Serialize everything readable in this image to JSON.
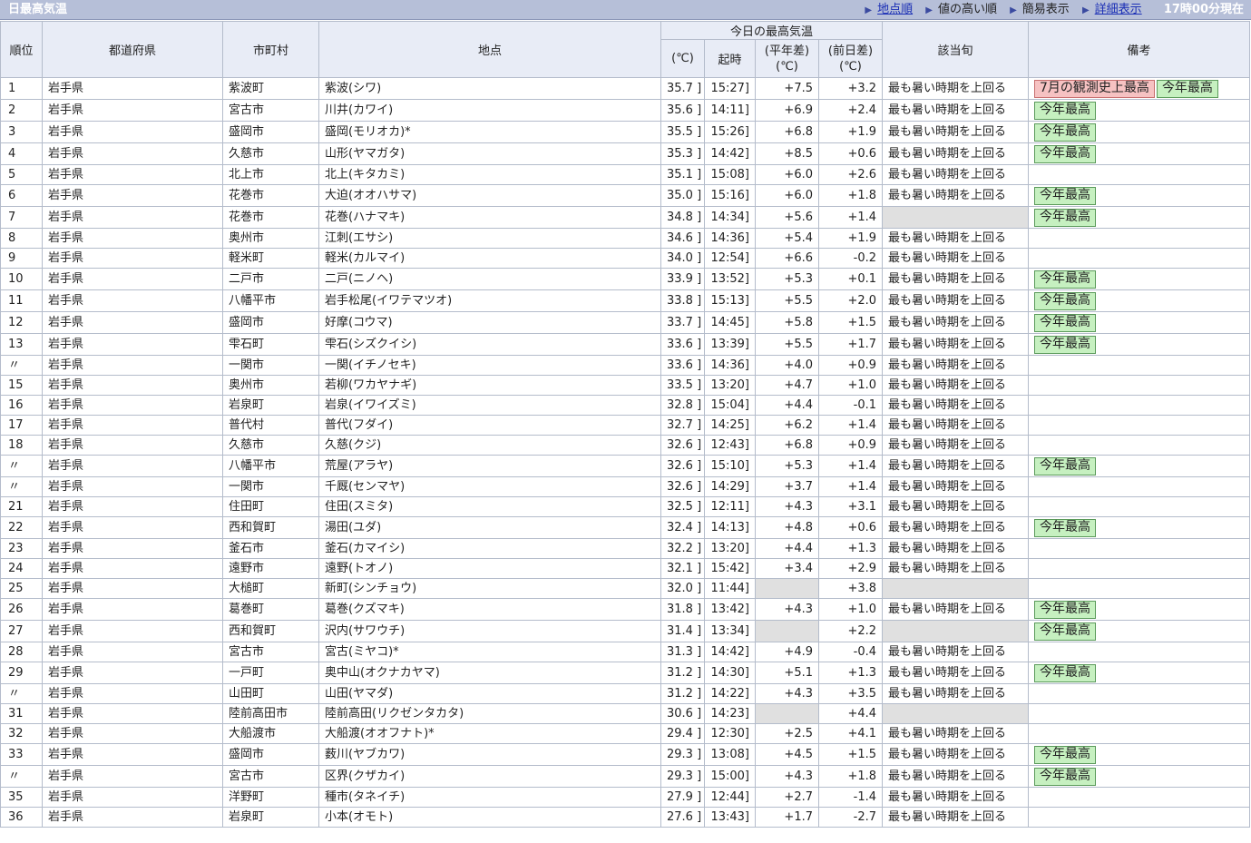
{
  "header": {
    "title": "日最高気温",
    "links": [
      {
        "label": "地点順",
        "type": "link"
      },
      {
        "label": "値の高い順",
        "type": "current"
      },
      {
        "label": "簡易表示",
        "type": "current"
      },
      {
        "label": "詳細表示",
        "type": "link"
      }
    ],
    "time": "17時00分現在"
  },
  "columns": {
    "rank": "順位",
    "pref": "都道府県",
    "city": "市町村",
    "station": "地点",
    "group": "今日の最高気温",
    "temp_unit": "(℃)",
    "time": "起時",
    "normal_diff": "(平年差)\n(℃)",
    "prev_diff": "(前日差)\n(℃)",
    "period": "該当旬",
    "note": "備考"
  },
  "colors": {
    "header_bg": "#b6bfd8",
    "th_bg": "#e8ecf6",
    "badge_green": "#c6f0c0",
    "badge_red": "#f6c2c2",
    "gray_cell": "#e0e0e0"
  },
  "rows": [
    {
      "rank": "1",
      "pref": "岩手県",
      "city": "紫波町",
      "station": "紫波(シワ)",
      "temp": "35.7 ]",
      "time": "15:27]",
      "normal": "+7.5",
      "prev": "+3.2",
      "period": "最も暑い時期を上回る",
      "notes": [
        {
          "text": "7月の観測史上最高",
          "color": "red"
        },
        {
          "text": "今年最高",
          "color": "green"
        }
      ]
    },
    {
      "rank": "2",
      "pref": "岩手県",
      "city": "宮古市",
      "station": "川井(カワイ)",
      "temp": "35.6 ]",
      "time": "14:11]",
      "normal": "+6.9",
      "prev": "+2.4",
      "period": "最も暑い時期を上回る",
      "notes": [
        {
          "text": "今年最高",
          "color": "green"
        }
      ]
    },
    {
      "rank": "3",
      "pref": "岩手県",
      "city": "盛岡市",
      "station": "盛岡(モリオカ)*",
      "temp": "35.5 ]",
      "time": "15:26]",
      "normal": "+6.8",
      "prev": "+1.9",
      "period": "最も暑い時期を上回る",
      "notes": [
        {
          "text": "今年最高",
          "color": "green"
        }
      ]
    },
    {
      "rank": "4",
      "pref": "岩手県",
      "city": "久慈市",
      "station": "山形(ヤマガタ)",
      "temp": "35.3 ]",
      "time": "14:42]",
      "normal": "+8.5",
      "prev": "+0.6",
      "period": "最も暑い時期を上回る",
      "notes": [
        {
          "text": "今年最高",
          "color": "green"
        }
      ]
    },
    {
      "rank": "5",
      "pref": "岩手県",
      "city": "北上市",
      "station": "北上(キタカミ)",
      "temp": "35.1 ]",
      "time": "15:08]",
      "normal": "+6.0",
      "prev": "+2.6",
      "period": "最も暑い時期を上回る",
      "notes": []
    },
    {
      "rank": "6",
      "pref": "岩手県",
      "city": "花巻市",
      "station": "大迫(オオハサマ)",
      "temp": "35.0 ]",
      "time": "15:16]",
      "normal": "+6.0",
      "prev": "+1.8",
      "period": "最も暑い時期を上回る",
      "notes": [
        {
          "text": "今年最高",
          "color": "green"
        }
      ]
    },
    {
      "rank": "7",
      "pref": "岩手県",
      "city": "花巻市",
      "station": "花巻(ハナマキ)",
      "temp": "34.8 ]",
      "time": "14:34]",
      "normal": "+5.6",
      "prev": "+1.4",
      "period": "",
      "notes": [
        {
          "text": "今年最高",
          "color": "green"
        }
      ]
    },
    {
      "rank": "8",
      "pref": "岩手県",
      "city": "奥州市",
      "station": "江刺(エサシ)",
      "temp": "34.6 ]",
      "time": "14:36]",
      "normal": "+5.4",
      "prev": "+1.9",
      "period": "最も暑い時期を上回る",
      "notes": []
    },
    {
      "rank": "9",
      "pref": "岩手県",
      "city": "軽米町",
      "station": "軽米(カルマイ)",
      "temp": "34.0 ]",
      "time": "12:54]",
      "normal": "+6.6",
      "prev": "-0.2",
      "period": "最も暑い時期を上回る",
      "notes": []
    },
    {
      "rank": "10",
      "pref": "岩手県",
      "city": "二戸市",
      "station": "二戸(ニノヘ)",
      "temp": "33.9 ]",
      "time": "13:52]",
      "normal": "+5.3",
      "prev": "+0.1",
      "period": "最も暑い時期を上回る",
      "notes": [
        {
          "text": "今年最高",
          "color": "green"
        }
      ]
    },
    {
      "rank": "11",
      "pref": "岩手県",
      "city": "八幡平市",
      "station": "岩手松尾(イワテマツオ)",
      "temp": "33.8 ]",
      "time": "15:13]",
      "normal": "+5.5",
      "prev": "+2.0",
      "period": "最も暑い時期を上回る",
      "notes": [
        {
          "text": "今年最高",
          "color": "green"
        }
      ]
    },
    {
      "rank": "12",
      "pref": "岩手県",
      "city": "盛岡市",
      "station": "好摩(コウマ)",
      "temp": "33.7 ]",
      "time": "14:45]",
      "normal": "+5.8",
      "prev": "+1.5",
      "period": "最も暑い時期を上回る",
      "notes": [
        {
          "text": "今年最高",
          "color": "green"
        }
      ]
    },
    {
      "rank": "13",
      "pref": "岩手県",
      "city": "雫石町",
      "station": "雫石(シズクイシ)",
      "temp": "33.6 ]",
      "time": "13:39]",
      "normal": "+5.5",
      "prev": "+1.7",
      "period": "最も暑い時期を上回る",
      "notes": [
        {
          "text": "今年最高",
          "color": "green"
        }
      ]
    },
    {
      "rank": "〃",
      "pref": "岩手県",
      "city": "一関市",
      "station": "一関(イチノセキ)",
      "temp": "33.6 ]",
      "time": "14:36]",
      "normal": "+4.0",
      "prev": "+0.9",
      "period": "最も暑い時期を上回る",
      "notes": []
    },
    {
      "rank": "15",
      "pref": "岩手県",
      "city": "奥州市",
      "station": "若柳(ワカヤナギ)",
      "temp": "33.5 ]",
      "time": "13:20]",
      "normal": "+4.7",
      "prev": "+1.0",
      "period": "最も暑い時期を上回る",
      "notes": []
    },
    {
      "rank": "16",
      "pref": "岩手県",
      "city": "岩泉町",
      "station": "岩泉(イワイズミ)",
      "temp": "32.8 ]",
      "time": "15:04]",
      "normal": "+4.4",
      "prev": "-0.1",
      "period": "最も暑い時期を上回る",
      "notes": []
    },
    {
      "rank": "17",
      "pref": "岩手県",
      "city": "普代村",
      "station": "普代(フダイ)",
      "temp": "32.7 ]",
      "time": "14:25]",
      "normal": "+6.2",
      "prev": "+1.4",
      "period": "最も暑い時期を上回る",
      "notes": []
    },
    {
      "rank": "18",
      "pref": "岩手県",
      "city": "久慈市",
      "station": "久慈(クジ)",
      "temp": "32.6 ]",
      "time": "12:43]",
      "normal": "+6.8",
      "prev": "+0.9",
      "period": "最も暑い時期を上回る",
      "notes": []
    },
    {
      "rank": "〃",
      "pref": "岩手県",
      "city": "八幡平市",
      "station": "荒屋(アラヤ)",
      "temp": "32.6 ]",
      "time": "15:10]",
      "normal": "+5.3",
      "prev": "+1.4",
      "period": "最も暑い時期を上回る",
      "notes": [
        {
          "text": "今年最高",
          "color": "green"
        }
      ]
    },
    {
      "rank": "〃",
      "pref": "岩手県",
      "city": "一関市",
      "station": "千厩(センマヤ)",
      "temp": "32.6 ]",
      "time": "14:29]",
      "normal": "+3.7",
      "prev": "+1.4",
      "period": "最も暑い時期を上回る",
      "notes": []
    },
    {
      "rank": "21",
      "pref": "岩手県",
      "city": "住田町",
      "station": "住田(スミタ)",
      "temp": "32.5 ]",
      "time": "12:11]",
      "normal": "+4.3",
      "prev": "+3.1",
      "period": "最も暑い時期を上回る",
      "notes": []
    },
    {
      "rank": "22",
      "pref": "岩手県",
      "city": "西和賀町",
      "station": "湯田(ユダ)",
      "temp": "32.4 ]",
      "time": "14:13]",
      "normal": "+4.8",
      "prev": "+0.6",
      "period": "最も暑い時期を上回る",
      "notes": [
        {
          "text": "今年最高",
          "color": "green"
        }
      ]
    },
    {
      "rank": "23",
      "pref": "岩手県",
      "city": "釜石市",
      "station": "釜石(カマイシ)",
      "temp": "32.2 ]",
      "time": "13:20]",
      "normal": "+4.4",
      "prev": "+1.3",
      "period": "最も暑い時期を上回る",
      "notes": []
    },
    {
      "rank": "24",
      "pref": "岩手県",
      "city": "遠野市",
      "station": "遠野(トオノ)",
      "temp": "32.1 ]",
      "time": "15:42]",
      "normal": "+3.4",
      "prev": "+2.9",
      "period": "最も暑い時期を上回る",
      "notes": []
    },
    {
      "rank": "25",
      "pref": "岩手県",
      "city": "大槌町",
      "station": "新町(シンチョウ)",
      "temp": "32.0 ]",
      "time": "11:44]",
      "normal": "",
      "prev": "+3.8",
      "period": "",
      "notes": []
    },
    {
      "rank": "26",
      "pref": "岩手県",
      "city": "葛巻町",
      "station": "葛巻(クズマキ)",
      "temp": "31.8 ]",
      "time": "13:42]",
      "normal": "+4.3",
      "prev": "+1.0",
      "period": "最も暑い時期を上回る",
      "notes": [
        {
          "text": "今年最高",
          "color": "green"
        }
      ]
    },
    {
      "rank": "27",
      "pref": "岩手県",
      "city": "西和賀町",
      "station": "沢内(サワウチ)",
      "temp": "31.4 ]",
      "time": "13:34]",
      "normal": "",
      "prev": "+2.2",
      "period": "",
      "notes": [
        {
          "text": "今年最高",
          "color": "green"
        }
      ]
    },
    {
      "rank": "28",
      "pref": "岩手県",
      "city": "宮古市",
      "station": "宮古(ミヤコ)*",
      "temp": "31.3 ]",
      "time": "14:42]",
      "normal": "+4.9",
      "prev": "-0.4",
      "period": "最も暑い時期を上回る",
      "notes": []
    },
    {
      "rank": "29",
      "pref": "岩手県",
      "city": "一戸町",
      "station": "奥中山(オクナカヤマ)",
      "temp": "31.2 ]",
      "time": "14:30]",
      "normal": "+5.1",
      "prev": "+1.3",
      "period": "最も暑い時期を上回る",
      "notes": [
        {
          "text": "今年最高",
          "color": "green"
        }
      ]
    },
    {
      "rank": "〃",
      "pref": "岩手県",
      "city": "山田町",
      "station": "山田(ヤマダ)",
      "temp": "31.2 ]",
      "time": "14:22]",
      "normal": "+4.3",
      "prev": "+3.5",
      "period": "最も暑い時期を上回る",
      "notes": []
    },
    {
      "rank": "31",
      "pref": "岩手県",
      "city": "陸前高田市",
      "station": "陸前高田(リクゼンタカタ)",
      "temp": "30.6 ]",
      "time": "14:23]",
      "normal": "",
      "prev": "+4.4",
      "period": "",
      "notes": []
    },
    {
      "rank": "32",
      "pref": "岩手県",
      "city": "大船渡市",
      "station": "大船渡(オオフナト)*",
      "temp": "29.4 ]",
      "time": "12:30]",
      "normal": "+2.5",
      "prev": "+4.1",
      "period": "最も暑い時期を上回る",
      "notes": []
    },
    {
      "rank": "33",
      "pref": "岩手県",
      "city": "盛岡市",
      "station": "薮川(ヤブカワ)",
      "temp": "29.3 ]",
      "time": "13:08]",
      "normal": "+4.5",
      "prev": "+1.5",
      "period": "最も暑い時期を上回る",
      "notes": [
        {
          "text": "今年最高",
          "color": "green"
        }
      ]
    },
    {
      "rank": "〃",
      "pref": "岩手県",
      "city": "宮古市",
      "station": "区界(クザカイ)",
      "temp": "29.3 ]",
      "time": "15:00]",
      "normal": "+4.3",
      "prev": "+1.8",
      "period": "最も暑い時期を上回る",
      "notes": [
        {
          "text": "今年最高",
          "color": "green"
        }
      ]
    },
    {
      "rank": "35",
      "pref": "岩手県",
      "city": "洋野町",
      "station": "種市(タネイチ)",
      "temp": "27.9 ]",
      "time": "12:44]",
      "normal": "+2.7",
      "prev": "-1.4",
      "period": "最も暑い時期を上回る",
      "notes": []
    },
    {
      "rank": "36",
      "pref": "岩手県",
      "city": "岩泉町",
      "station": "小本(オモト)",
      "temp": "27.6 ]",
      "time": "13:43]",
      "normal": "+1.7",
      "prev": "-2.7",
      "period": "最も暑い時期を上回る",
      "notes": []
    }
  ]
}
